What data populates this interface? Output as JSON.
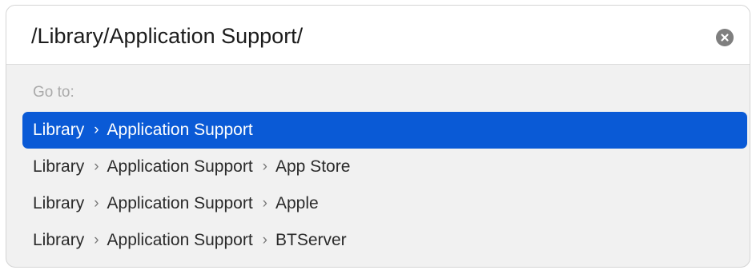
{
  "path_field": {
    "value": "/Library/Application Support/"
  },
  "clear_icon": "close-circle-icon",
  "goto_label": "Go to:",
  "separator": "›",
  "suggestions": [
    {
      "parts": [
        "Library",
        "Application Support"
      ],
      "selected": true
    },
    {
      "parts": [
        "Library",
        "Application Support",
        "App Store"
      ],
      "selected": false
    },
    {
      "parts": [
        "Library",
        "Application Support",
        "Apple"
      ],
      "selected": false
    },
    {
      "parts": [
        "Library",
        "Application Support",
        "BTServer"
      ],
      "selected": false
    }
  ],
  "colors": {
    "selection": "#0a5ad6",
    "dialog_bg": "#f1f1f1",
    "secondary_text": "#aaaaaa"
  }
}
